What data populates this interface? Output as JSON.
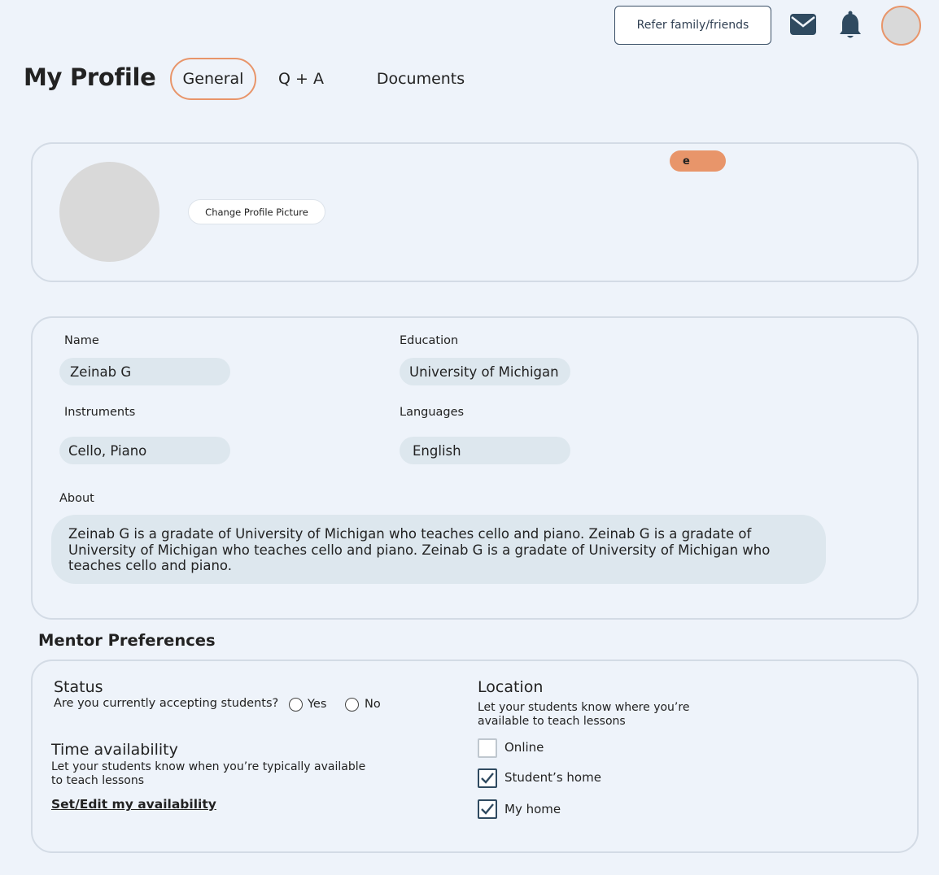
{
  "header": {
    "refer_label": "Refer family/friends",
    "icons": {
      "mail": "mail-icon",
      "bell": "bell-icon"
    }
  },
  "page": {
    "title": "My Profile",
    "tabs": [
      "General",
      "Q + A",
      "Documents"
    ],
    "active_tab": "General"
  },
  "photo_card": {
    "change_picture_label": "Change Profile Picture",
    "edit_badge": "e"
  },
  "info": {
    "name_label": "Name",
    "name_value": "Zeinab G",
    "education_label": "Education",
    "education_value": "University of Michigan",
    "instruments_label": "Instruments",
    "instruments_value": "Cello, Piano",
    "languages_label": "Languages",
    "languages_value": "English",
    "about_label": "About",
    "about_value": "Zeinab G is a gradate of University of Michigan who teaches cello and piano. Zeinab G is a gradate of University of Michigan who teaches cello and piano. Zeinab G is a gradate of University of Michigan who teaches cello and piano."
  },
  "mentor": {
    "heading": "Mentor Preferences",
    "status_title": "Status",
    "status_question": "Are you currently accepting students?",
    "yes_label": "Yes",
    "no_label": "No",
    "time_title": "Time availability",
    "time_desc_line1": "Let your students know when you’re typically available",
    "time_desc_line2": "to teach lessons",
    "availability_link": "Set/Edit my availability",
    "location_title": "Location",
    "location_desc_line1": "Let your students know where you’re",
    "location_desc_line2": "available to teach lessons",
    "locations": [
      {
        "label": "Online",
        "checked": false
      },
      {
        "label": "Student’s home",
        "checked": true
      },
      {
        "label": "My home",
        "checked": true
      }
    ]
  },
  "colors": {
    "background": "#eef3fa",
    "accent": "#e8956a",
    "icon_dark": "#2f4a60",
    "pill": "#dde7ee"
  }
}
